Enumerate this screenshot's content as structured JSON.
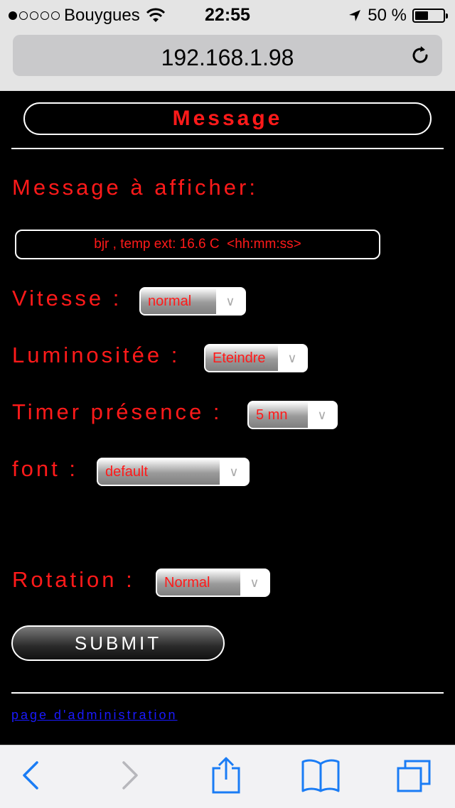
{
  "status_bar": {
    "carrier": "Bouygues",
    "time": "22:55",
    "battery": "50 %",
    "battery_level": 0.5,
    "signal_bars_filled": 1,
    "signal_bars_total": 5
  },
  "browser": {
    "url": "192.168.1.98"
  },
  "page": {
    "title": "Message",
    "message_label": "Message à  afficher:",
    "message_value": "bjr , temp ext: 16.6 C  <hh:mm:ss>",
    "vitesse_label": "Vitesse :",
    "vitesse_value": "normal",
    "luminosite_label": "Luminositée :",
    "luminosite_value": "Eteindre",
    "timer_label": "Timer présence :",
    "timer_value": "5 mn",
    "font_label": "font :",
    "font_value": "default",
    "rotation_label": "Rotation :",
    "rotation_value": "Normal",
    "submit_label": "SUBMIT",
    "admin_link": "page d'administration"
  },
  "colors": {
    "accent_red": "#ff1a1a",
    "ios_blue": "#1a7cf5",
    "link_blue": "#1a1aff"
  },
  "icons": {
    "reload": "reload-icon",
    "back": "back-chevron-icon",
    "forward": "forward-chevron-icon",
    "share": "share-icon",
    "bookmarks": "bookmarks-icon",
    "tabs": "tabs-icon",
    "wifi": "wifi-icon",
    "location": "location-arrow-icon",
    "battery": "battery-icon"
  }
}
